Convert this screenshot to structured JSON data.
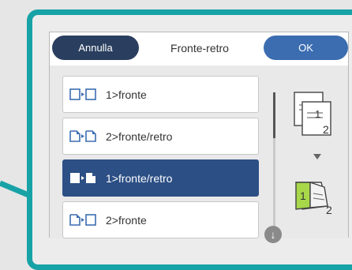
{
  "header": {
    "cancel_label": "Annulla",
    "title": "Fronte-retro",
    "ok_label": "OK"
  },
  "options": [
    {
      "label": "1>fronte",
      "icon": "single-to-single-icon",
      "selected": false
    },
    {
      "label": "2>fronte/retro",
      "icon": "double-to-double-icon",
      "selected": false
    },
    {
      "label": "1>fronte/retro",
      "icon": "single-to-double-icon",
      "selected": true
    },
    {
      "label": "2>fronte",
      "icon": "double-to-single-icon",
      "selected": false
    }
  ],
  "preview": {
    "original_pages": [
      "1",
      "2"
    ],
    "result_pages": [
      "1",
      "2"
    ]
  },
  "colors": {
    "frame": "#17a2a6",
    "cancel_bg": "#2a3f5f",
    "ok_bg": "#3b6db0",
    "selected_bg": "#2c4f85",
    "result_highlight": "#a8d84a"
  }
}
